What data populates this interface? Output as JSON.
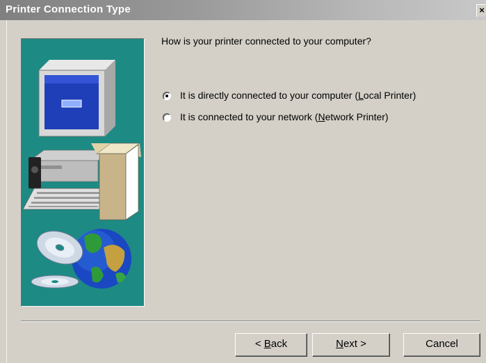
{
  "window": {
    "title": "Printer Connection Type",
    "close_glyph": "×"
  },
  "wizard": {
    "question": "How is your printer connected to your computer?",
    "options": [
      {
        "before": "It is directly connected to your computer (",
        "key": "L",
        "after": "ocal Printer)",
        "selected": true
      },
      {
        "before": "It is connected to your network (",
        "key": "N",
        "after": "etwork Printer)",
        "selected": false
      }
    ]
  },
  "buttons": {
    "back": {
      "before": "< ",
      "key": "B",
      "after": "ack"
    },
    "next": {
      "key": "N",
      "after": "ext >"
    },
    "cancel": "Cancel"
  },
  "colors": {
    "panel_teal": "#1d8a84",
    "dialog_face": "#d4d0c8"
  },
  "icons": [
    "computer-illustration",
    "printer-box-illustration",
    "cd-disc-illustration",
    "globe-illustration"
  ]
}
